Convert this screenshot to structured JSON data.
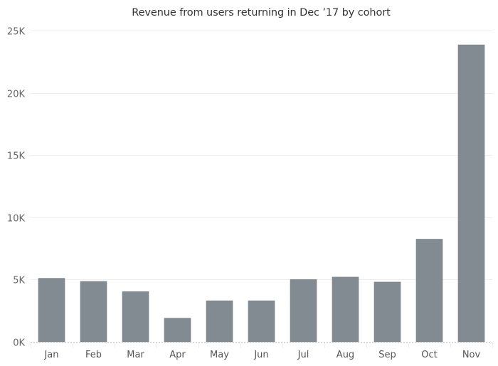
{
  "chart_data": {
    "type": "bar",
    "title": "Revenue from users returning in Dec ’17 by cohort",
    "xlabel": "",
    "ylabel": "",
    "categories": [
      "Jan",
      "Feb",
      "Mar",
      "Apr",
      "May",
      "Jun",
      "Jul",
      "Aug",
      "Sep",
      "Oct",
      "Nov"
    ],
    "values": [
      5100,
      4850,
      4030,
      1900,
      3300,
      3300,
      5000,
      5200,
      4800,
      8250,
      23850
    ],
    "ylim": [
      0,
      25000
    ],
    "yticks": [
      0,
      5000,
      10000,
      15000,
      20000,
      25000
    ],
    "ytick_labels": [
      "0K",
      "5K",
      "10K",
      "15K",
      "20K",
      "25K"
    ],
    "grid": true,
    "legend": "none",
    "colors": {
      "bar": "#838b92",
      "bar_edge": "#767e85",
      "grid": "#eeeeee",
      "baseline": "#bbbbbb"
    }
  }
}
